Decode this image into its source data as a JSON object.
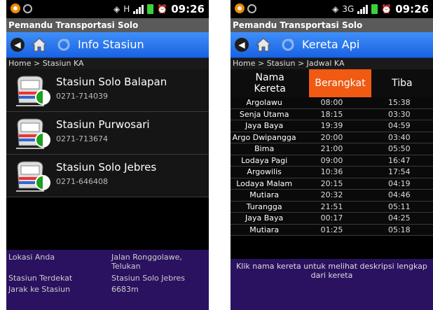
{
  "app": {
    "title": "Pemandu Transportasi Solo"
  },
  "status": {
    "time": "09:26",
    "hplus": "H",
    "three_g": "3G"
  },
  "screen_left": {
    "nav_title": "Info Stasiun",
    "breadcrumb": "Home > Stasiun KA",
    "stations": [
      {
        "name": "Stasiun Solo Balapan",
        "phone": "0271-714039"
      },
      {
        "name": "Stasiun Purwosari",
        "phone": "0271-713674"
      },
      {
        "name": "Stasiun Solo Jebres",
        "phone": "0271-646408"
      }
    ],
    "info": {
      "location_label": "Lokasi Anda",
      "location_value": "Jalan Ronggolawe, Telukan",
      "nearest_label": "Stasiun Terdekat",
      "nearest_value": "Stasiun Solo Jebres",
      "distance_label": "Jarak ke Stasiun",
      "distance_value": "6683m"
    }
  },
  "screen_right": {
    "nav_title": "Kereta Api",
    "breadcrumb": "Home > Stasiun > Jadwal KA",
    "headers": {
      "name": "Nama Kereta",
      "depart": "Berangkat",
      "arrive": "Tiba"
    },
    "rows": [
      {
        "name": "Argolawu",
        "depart": "08:00",
        "arrive": "15:38"
      },
      {
        "name": "Senja Utama",
        "depart": "18:15",
        "arrive": "03:30"
      },
      {
        "name": "Jaya Baya",
        "depart": "19:39",
        "arrive": "04:59"
      },
      {
        "name": "Argo Dwipangga",
        "depart": "20:00",
        "arrive": "03:40"
      },
      {
        "name": "Bima",
        "depart": "21:00",
        "arrive": "05:50"
      },
      {
        "name": "Lodaya Pagi",
        "depart": "09:00",
        "arrive": "16:47"
      },
      {
        "name": "Argowilis",
        "depart": "10:36",
        "arrive": "17:54"
      },
      {
        "name": "Lodaya Malam",
        "depart": "20:15",
        "arrive": "04:19"
      },
      {
        "name": "Mutiara",
        "depart": "20:32",
        "arrive": "04:46"
      },
      {
        "name": "Turangga",
        "depart": "21:51",
        "arrive": "05:11"
      },
      {
        "name": "Jaya Baya",
        "depart": "00:17",
        "arrive": "04:25"
      },
      {
        "name": "Mutiara",
        "depart": "01:25",
        "arrive": "05:18"
      }
    ],
    "footnote": "Klik nama kereta untuk melihat deskripsi lengkap dari kereta"
  },
  "icons": [
    "back-icon",
    "home-icon",
    "refresh-icon",
    "train-icon",
    "wifi-icon",
    "signal-icon",
    "battery-icon",
    "alarm-icon"
  ],
  "colors": {
    "nav_blue": "#2f7cf0",
    "title_gray": "#5a5a5a",
    "active_header": "#f05a13",
    "info_panel": "#2a1260"
  }
}
